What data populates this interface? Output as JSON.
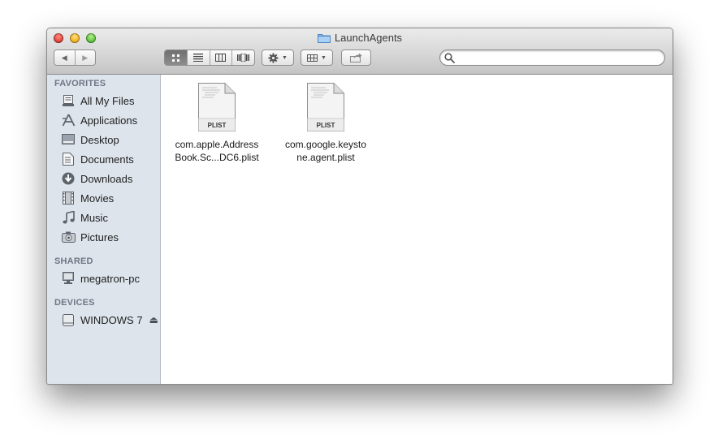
{
  "window": {
    "title": "LaunchAgents"
  },
  "toolbar": {
    "back_label": "◀",
    "forward_label": "▶",
    "search": {
      "placeholder": "",
      "value": ""
    }
  },
  "sidebar": {
    "favorites_header": "FAVORITES",
    "favorites": [
      {
        "label": "All My Files",
        "icon": "all-files-icon"
      },
      {
        "label": "Applications",
        "icon": "applications-icon"
      },
      {
        "label": "Desktop",
        "icon": "desktop-icon"
      },
      {
        "label": "Documents",
        "icon": "documents-icon"
      },
      {
        "label": "Downloads",
        "icon": "downloads-icon"
      },
      {
        "label": "Movies",
        "icon": "movies-icon"
      },
      {
        "label": "Music",
        "icon": "music-icon"
      },
      {
        "label": "Pictures",
        "icon": "pictures-icon"
      }
    ],
    "shared_header": "SHARED",
    "shared": [
      {
        "label": "megatron-pc",
        "icon": "computer-icon"
      }
    ],
    "devices_header": "DEVICES",
    "devices": [
      {
        "label": "WINDOWS 7",
        "icon": "drive-icon",
        "eject": "⏏"
      }
    ]
  },
  "files": [
    {
      "badge": "PLIST",
      "name_line1": "com.apple.Address",
      "name_line2": "Book.Sc...DC6.plist"
    },
    {
      "badge": "PLIST",
      "name_line1": "com.google.keysto",
      "name_line2": "ne.agent.plist"
    }
  ],
  "colors": {
    "sidebar_bg": "#dde4ec",
    "section_header": "#6e7785",
    "folder_blue": "#7fb3e6"
  }
}
